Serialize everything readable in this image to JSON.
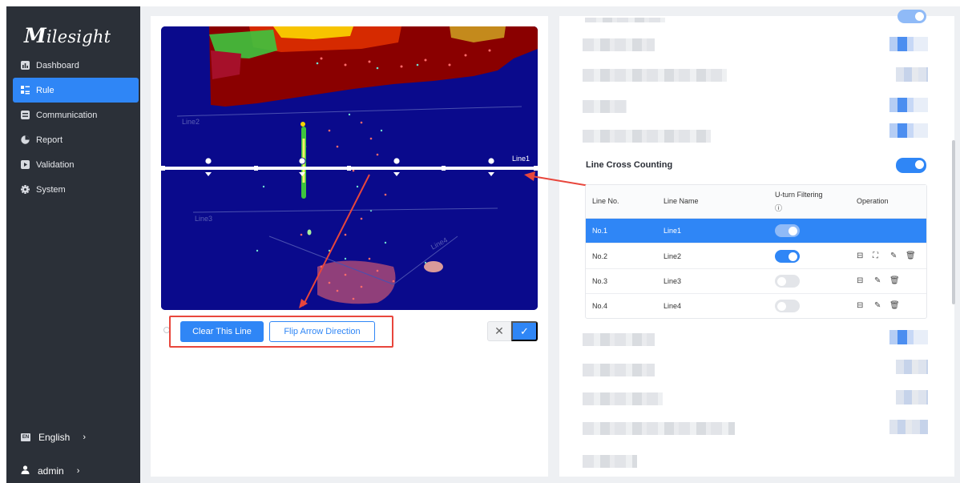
{
  "brand": {
    "logo_initial": "M",
    "logo_rest": "ilesight"
  },
  "sidebar": {
    "items": [
      {
        "label": "Dashboard",
        "icon": "bar-chart-icon"
      },
      {
        "label": "Rule",
        "icon": "rule-icon",
        "active": true
      },
      {
        "label": "Communication",
        "icon": "communication-icon"
      },
      {
        "label": "Report",
        "icon": "pie-chart-icon"
      },
      {
        "label": "Validation",
        "icon": "validation-icon"
      },
      {
        "label": "System",
        "icon": "gear-icon"
      }
    ],
    "language": {
      "badge": "EN",
      "label": "English",
      "chevron": "›"
    },
    "user": {
      "label": "admin",
      "chevron": "›"
    }
  },
  "canvas": {
    "lines": [
      {
        "label": "Line1",
        "selected": true
      },
      {
        "label": "Line2"
      },
      {
        "label": "Line3"
      },
      {
        "label": "Line4"
      }
    ]
  },
  "actions": {
    "clear_label": "Clear This Line",
    "flip_label": "Flip Arrow Direction",
    "cancel_symbol": "✕",
    "confirm_symbol": "✓"
  },
  "line_cross": {
    "title": "Line Cross Counting",
    "enabled": true,
    "headers": {
      "line_no": "Line No.",
      "line_name": "Line Name",
      "uturn": "U-turn Filtering",
      "uturn_info": "ⓘ",
      "operation": "Operation"
    },
    "rows": [
      {
        "no": "No.1",
        "name": "Line1",
        "uturn": true,
        "selected": true,
        "ops": []
      },
      {
        "no": "No.2",
        "name": "Line2",
        "uturn": true,
        "ops": [
          "⊟",
          "⛶",
          "✎",
          "🗑"
        ]
      },
      {
        "no": "No.3",
        "name": "Line3",
        "uturn": false,
        "ops": [
          "⊟",
          "✎",
          "🗑"
        ]
      },
      {
        "no": "No.4",
        "name": "Line4",
        "uturn": false,
        "ops": [
          "⊟",
          "✎",
          "🗑"
        ]
      }
    ]
  },
  "colors": {
    "accent": "#2f86f6",
    "sidebar_bg": "#2b3038",
    "annotation": "#e8463c",
    "heatmap_bg": "#0a0a8c"
  }
}
